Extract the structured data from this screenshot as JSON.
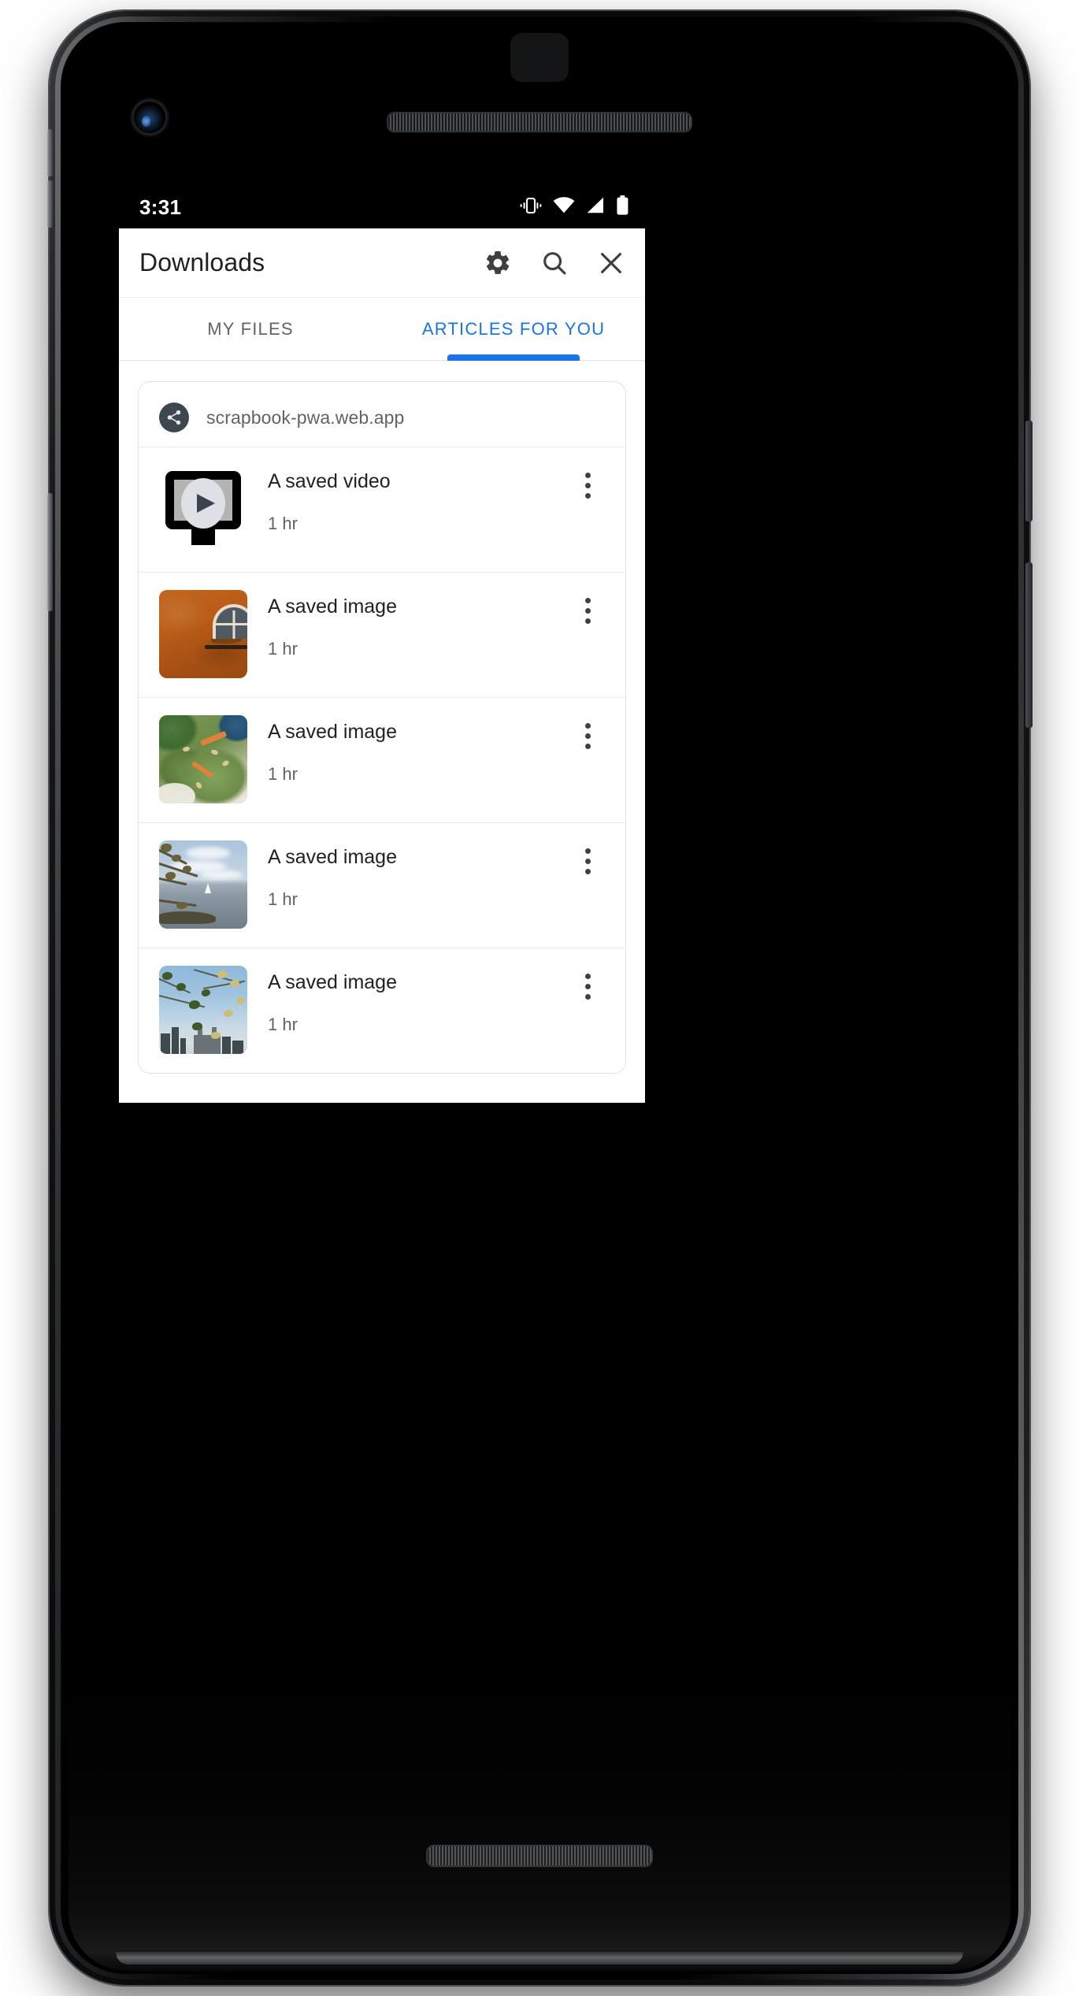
{
  "colors": {
    "accent_blue": "#1a73e8",
    "text_primary": "#202124",
    "text_secondary": "#5f6368",
    "status_bar_bg": "#000000",
    "card_border": "#e0e3e6",
    "favicon_bg": "#3c4750"
  },
  "status_bar": {
    "time": "3:31",
    "icons": [
      "vibrate-icon",
      "wifi-icon",
      "cellular-signal-icon",
      "battery-icon"
    ]
  },
  "app_bar": {
    "title": "Downloads",
    "actions": [
      {
        "name": "gear-icon",
        "label": "Settings"
      },
      {
        "name": "search-icon",
        "label": "Search"
      },
      {
        "name": "close-icon",
        "label": "Close"
      }
    ]
  },
  "tabs": [
    {
      "label": "MY FILES",
      "active": false
    },
    {
      "label": "ARTICLES FOR YOU",
      "active": true
    }
  ],
  "card": {
    "favicon": "share-icon",
    "site_name": "scrapbook-pwa.web.app"
  },
  "downloads": [
    {
      "title": "A saved video",
      "time": "1 hr",
      "thumb": "video-placeholder-icon",
      "menu": "more-vert-icon"
    },
    {
      "title": "A saved image",
      "time": "1 hr",
      "thumb": "terracotta-wall-photo",
      "menu": "more-vert-icon"
    },
    {
      "title": "A saved image",
      "time": "1 hr",
      "thumb": "avocado-toast-photo",
      "menu": "more-vert-icon"
    },
    {
      "title": "A saved image",
      "time": "1 hr",
      "thumb": "lake-sailboat-photo",
      "menu": "more-vert-icon"
    },
    {
      "title": "A saved image",
      "time": "1 hr",
      "thumb": "city-skyline-photo",
      "menu": "more-vert-icon"
    }
  ]
}
